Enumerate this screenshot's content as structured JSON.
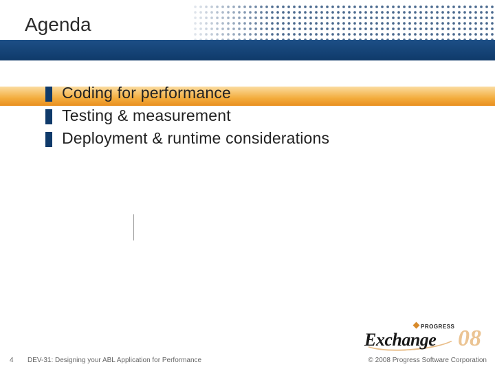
{
  "title": "Agenda",
  "bullets": [
    "Coding for performance",
    "Testing & measurement",
    "Deployment & runtime considerations"
  ],
  "footer": {
    "page": "4",
    "session": "DEV-31: Designing your ABL Application for Performance",
    "copyright": "© 2008 Progress Software Corporation"
  },
  "logo": {
    "brand": "PROGRESS",
    "event": "Exchange",
    "year": "08"
  }
}
